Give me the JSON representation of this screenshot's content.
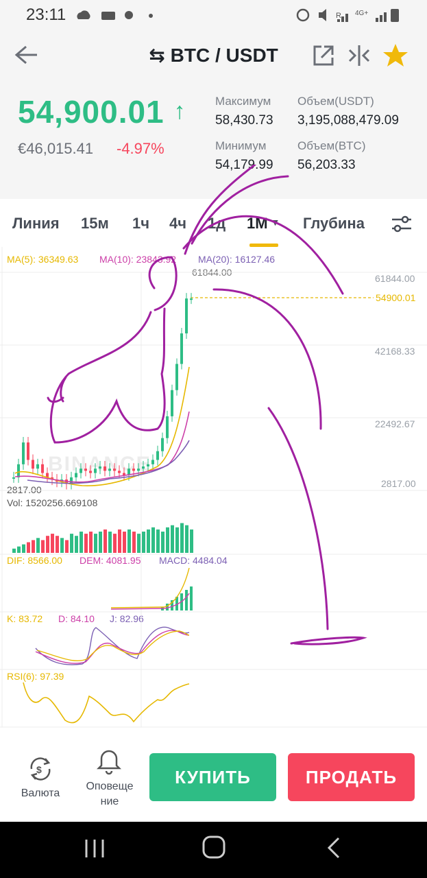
{
  "status_bar": {
    "time": "23:11"
  },
  "header": {
    "title": "BTC / USDT"
  },
  "price": {
    "last": "54,900.01",
    "last_color": "#2ebd85",
    "fiat": "€46,015.41",
    "change": "-4.97%",
    "change_color": "#f6465d"
  },
  "stats": {
    "high_label": "Максимум",
    "high": "58,430.73",
    "low_label": "Минимум",
    "low": "54,179.99",
    "vol_usdt_label": "Объем(USDT)",
    "vol_usdt": "3,195,088,479.09",
    "vol_btc_label": "Объем(BTC)",
    "vol_btc": "56,203.33"
  },
  "tabs": [
    {
      "label": "Линия"
    },
    {
      "label": "15м"
    },
    {
      "label": "1ч"
    },
    {
      "label": "4ч"
    },
    {
      "label": "1д"
    },
    {
      "label": "1М"
    },
    {
      "label": "Глубина"
    }
  ],
  "active_tab": "1М",
  "indicators": {
    "ma5": "MA(5): 36349.63",
    "ma10": "MA(10): 23843.92",
    "ma20": "MA(20): 16127.46",
    "high_marker": "61844.00",
    "low_marker": "2817.00",
    "vol": "Vol: 1520256.669108",
    "dif": "DIF: 8566.00",
    "dem": "DEM: 4081.95",
    "macd": "MACD: 4484.04",
    "k": "K: 83.72",
    "d": "D: 84.10",
    "j": "J: 82.96",
    "rsi": "RSI(6): 97.39",
    "watermark": "BINANCE"
  },
  "y_axis": [
    "61844.00",
    "42168.33",
    "22492.67",
    "2817.00"
  ],
  "current_price_tag": "54900.01",
  "bottom_nav": {
    "currency_label": "Валюта",
    "alerts_label": "Оповеще ние",
    "buy_label": "КУПИТЬ",
    "sell_label": "ПРОДАТЬ"
  },
  "colors": {
    "up": "#2ebd85",
    "down": "#f6465d",
    "ma5": "#e6b800",
    "ma10": "#cc3fa8",
    "ma20": "#7b5fb3",
    "accent": "#f0b90b"
  },
  "icons": [
    "back-arrow-icon",
    "swap-icon",
    "share-icon",
    "compare-icon",
    "star-icon",
    "settings-sliders-icon",
    "currency-exchange-icon",
    "bell-icon"
  ]
}
